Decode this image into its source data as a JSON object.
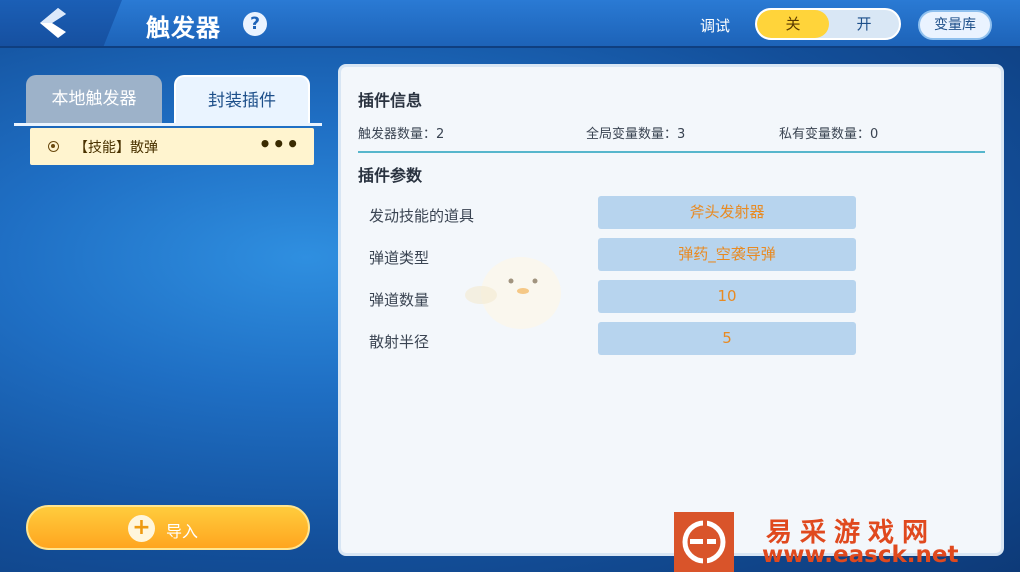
{
  "header": {
    "title": "触发器",
    "help_symbol": "?",
    "debug_label": "调试",
    "debug_toggle": {
      "off_label": "关",
      "on_label": "开",
      "selected": "关"
    },
    "var_lib_label": "变量库"
  },
  "left": {
    "tabs": [
      {
        "label": "本地触发器",
        "active": false
      },
      {
        "label": "封装插件",
        "active": true
      }
    ],
    "items": [
      {
        "name": "【技能】散弹",
        "more": "•••"
      }
    ],
    "import_icon": "+",
    "import_label": "导入"
  },
  "panel": {
    "info_title": "插件信息",
    "stats": [
      {
        "label": "触发器数量：",
        "value": "2"
      },
      {
        "label": "全局变量数量：",
        "value": "3"
      },
      {
        "label": "私有变量数量：",
        "value": "0"
      }
    ],
    "params_title": "插件参数",
    "params": [
      {
        "label": "发动技能的道具",
        "value": "斧头发射器"
      },
      {
        "label": "弹道类型",
        "value": "弹药_空袭导弹"
      },
      {
        "label": "弹道数量",
        "value": "10"
      },
      {
        "label": "散射半径",
        "value": "5"
      }
    ]
  },
  "watermark": {
    "line1": "易采游戏网",
    "line2": "www.easck.net"
  },
  "colors": {
    "accent_yellow": "#ffd43a",
    "param_value_text": "#e88a22",
    "panel_bg": "#f3f7fb"
  }
}
